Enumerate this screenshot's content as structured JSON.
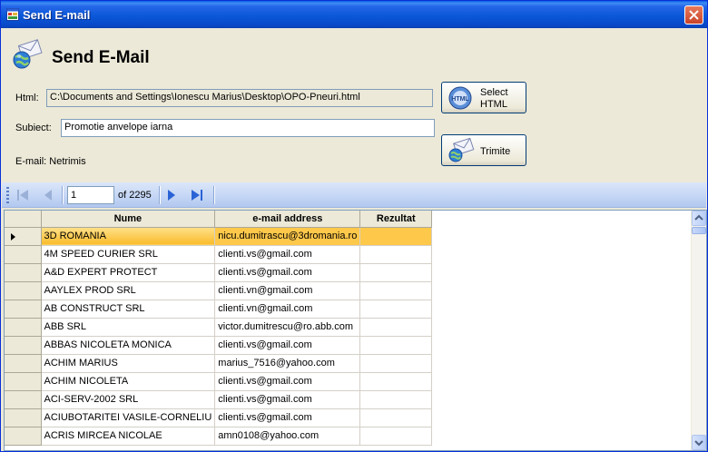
{
  "window": {
    "title": "Send E-mail",
    "close_icon": "close-icon"
  },
  "header": {
    "title": "Send E-Mail",
    "icon": "email-globe-icon"
  },
  "form": {
    "html_label": "Html:",
    "html_value": "C:\\Documents and Settings\\Ionescu Marius\\Desktop\\OPO-Pneuri.html",
    "subject_label": "Subiect:",
    "subject_value": "Promotie anvelope iarna",
    "email_status": "E-mail: Netrimis"
  },
  "buttons": {
    "select_html_line1": "Select",
    "select_html_line2": "HTML",
    "send": "Trimite"
  },
  "navigator": {
    "current_page": "1",
    "of_text": "of 2295"
  },
  "grid": {
    "columns": [
      "Nume",
      "e-mail address",
      "Rezultat"
    ],
    "rows": [
      {
        "name": "3D ROMANIA",
        "email": "nicu.dumitrascu@3dromania.ro",
        "result": ""
      },
      {
        "name": "4M SPEED CURIER SRL",
        "email": "clienti.vs@gmail.com",
        "result": ""
      },
      {
        "name": "A&D EXPERT PROTECT",
        "email": "clienti.vs@gmail.com",
        "result": ""
      },
      {
        "name": "AAYLEX PROD SRL",
        "email": "clienti.vn@gmail.com",
        "result": ""
      },
      {
        "name": "AB CONSTRUCT SRL",
        "email": "clienti.vn@gmail.com",
        "result": ""
      },
      {
        "name": "ABB SRL",
        "email": "victor.dumitrescu@ro.abb.com",
        "result": ""
      },
      {
        "name": "ABBAS NICOLETA MONICA",
        "email": "clienti.vs@gmail.com",
        "result": ""
      },
      {
        "name": "ACHIM MARIUS",
        "email": "marius_7516@yahoo.com",
        "result": ""
      },
      {
        "name": "ACHIM NICOLETA",
        "email": "clienti.vs@gmail.com",
        "result": ""
      },
      {
        "name": "ACI-SERV-2002 SRL",
        "email": "clienti.vs@gmail.com",
        "result": ""
      },
      {
        "name": "ACIUBOTARITEI VASILE-CORNELIU",
        "email": "clienti.vs@gmail.com",
        "result": ""
      },
      {
        "name": "ACRIS MIRCEA NICOLAE",
        "email": "amn0108@yahoo.com",
        "result": ""
      }
    ]
  },
  "colors": {
    "titlebar": "#0a58d8",
    "selection": "#fec84a",
    "navbar": "#c3d5f5"
  }
}
